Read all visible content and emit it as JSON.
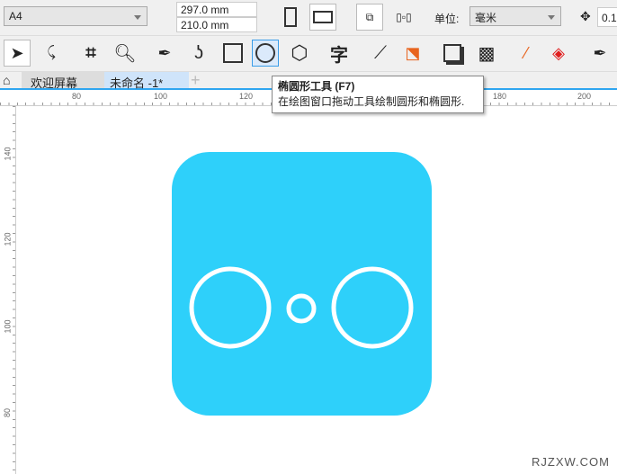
{
  "propertybar": {
    "page_size": "A4",
    "width": "297.0 mm",
    "height": "210.0 mm",
    "units_label": "单位:",
    "units_value": "毫米",
    "nudge_value": "0.1"
  },
  "toolbox": {
    "tools": [
      "pick-tool",
      "shape-tool",
      "crop-tool",
      "zoom-tool",
      "pen-tool",
      "freehand-tool",
      "rectangle-tool",
      "ellipse-tool",
      "polygon-tool",
      "text-tool",
      "dimension-tool",
      "connector-tool",
      "drop-shadow-tool",
      "transparency-tool",
      "eyedropper-tool",
      "interactive-fill-tool",
      "smart-fill-tool"
    ],
    "active": "ellipse-tool"
  },
  "tabs": [
    {
      "label": "欢迎屏幕"
    },
    {
      "label": "未命名 -1*",
      "active": true
    }
  ],
  "tooltip": {
    "title": "椭圆形工具 (F7)",
    "description": "在绘图窗口拖动工具绘制圆形和椭圆形."
  },
  "rulers": {
    "horizontal": [
      "80",
      "100",
      "120",
      "180",
      "200"
    ],
    "vertical": [
      "140",
      "120",
      "100",
      "80"
    ]
  },
  "canvas": {
    "shape_fill": "#2ed0fa",
    "stroke": "#ffffff"
  },
  "watermark": "RJZXW.COM"
}
